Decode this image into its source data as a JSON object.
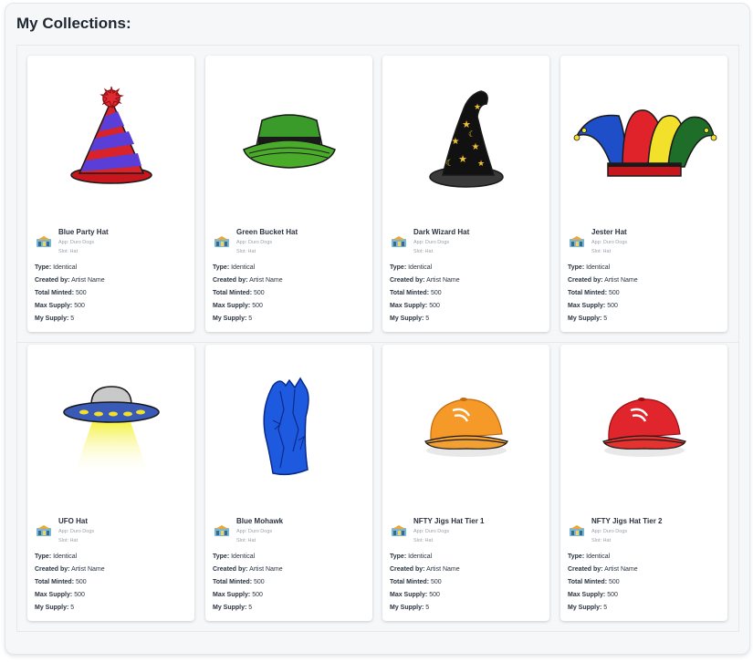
{
  "page": {
    "title": "My Collections:"
  },
  "cards": [
    {
      "title": "Blue Party Hat",
      "app": "App: Duro Dogs",
      "slot": "Slot: Hat",
      "image": "blue-party-hat",
      "type_label": "Type:",
      "type": "Identical",
      "created_label": "Created by:",
      "created_by": "Artist Name",
      "minted_label": "Total Minted:",
      "total_minted": "500",
      "max_label": "Max Supply:",
      "max_supply": "500",
      "mine_label": "My Supply:",
      "my_supply": "5"
    },
    {
      "title": "Green Bucket Hat",
      "app": "App: Duro Dogs",
      "slot": "Slot: Hat",
      "image": "green-bucket-hat",
      "type_label": "Type:",
      "type": "Identical",
      "created_label": "Created by:",
      "created_by": "Artist Name",
      "minted_label": "Total Minted:",
      "total_minted": "500",
      "max_label": "Max Supply:",
      "max_supply": "500",
      "mine_label": "My Supply:",
      "my_supply": "5"
    },
    {
      "title": "Dark Wizard Hat",
      "app": "App: Duro Dogs",
      "slot": "Slot: Hat",
      "image": "dark-wizard-hat",
      "type_label": "Type:",
      "type": "Identical",
      "created_label": "Created by:",
      "created_by": "Artist Name",
      "minted_label": "Total Minted:",
      "total_minted": "500",
      "max_label": "Max Supply:",
      "max_supply": "500",
      "mine_label": "My Supply:",
      "my_supply": "5"
    },
    {
      "title": "Jester Hat",
      "app": "App: Duro Dogs",
      "slot": "Slot: Hat",
      "image": "jester-hat",
      "type_label": "Type:",
      "type": "Identical",
      "created_label": "Created by:",
      "created_by": "Artist Name",
      "minted_label": "Total Minted:",
      "total_minted": "500",
      "max_label": "Max Supply:",
      "max_supply": "500",
      "mine_label": "My Supply:",
      "my_supply": "5"
    },
    {
      "title": "UFO Hat",
      "app": "App: Duro Dogs",
      "slot": "Slot: Hat",
      "image": "ufo-hat",
      "type_label": "Type:",
      "type": "Identical",
      "created_label": "Created by:",
      "created_by": "Artist Name",
      "minted_label": "Total Minted:",
      "total_minted": "500",
      "max_label": "Max Supply:",
      "max_supply": "500",
      "mine_label": "My Supply:",
      "my_supply": "5"
    },
    {
      "title": "Blue Mohawk",
      "app": "App: Duro Dogs",
      "slot": "Slot: Hat",
      "image": "blue-mohawk",
      "type_label": "Type:",
      "type": "Identical",
      "created_label": "Created by:",
      "created_by": "Artist Name",
      "minted_label": "Total Minted:",
      "total_minted": "500",
      "max_label": "Max Supply:",
      "max_supply": "500",
      "mine_label": "My Supply:",
      "my_supply": "5"
    },
    {
      "title": "NFTY Jigs Hat Tier 1",
      "app": "App: Duro Dogs",
      "slot": "Slot: Hat",
      "image": "orange-cap",
      "type_label": "Type:",
      "type": "Identical",
      "created_label": "Created by:",
      "created_by": "Artist Name",
      "minted_label": "Total Minted:",
      "total_minted": "500",
      "max_label": "Max Supply:",
      "max_supply": "500",
      "mine_label": "My Supply:",
      "my_supply": "5"
    },
    {
      "title": "NFTY Jigs Hat Tier 2",
      "app": "App: Duro Dogs",
      "slot": "Slot: Hat",
      "image": "red-cap",
      "type_label": "Type:",
      "type": "Identical",
      "created_label": "Created by:",
      "created_by": "Artist Name",
      "minted_label": "Total Minted:",
      "total_minted": "500",
      "max_label": "Max Supply:",
      "max_supply": "500",
      "mine_label": "My Supply:",
      "my_supply": "5"
    }
  ]
}
